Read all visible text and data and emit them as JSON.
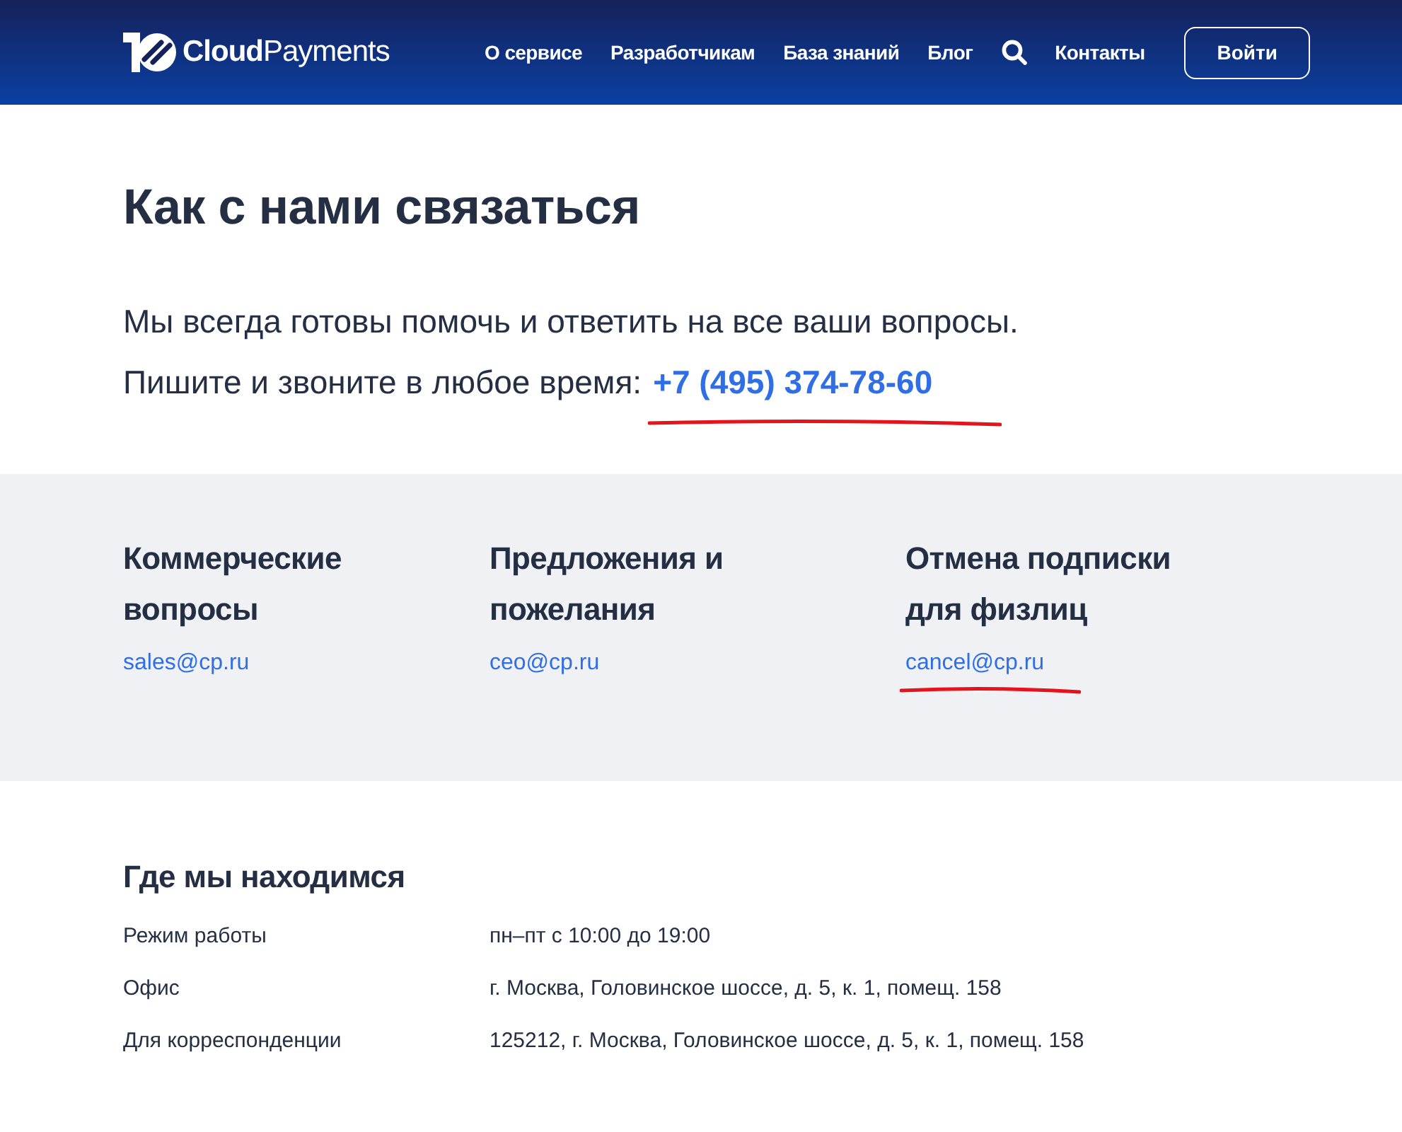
{
  "header": {
    "logo": "**Cloud**Payments",
    "nav": [
      "О сервисе",
      "Разработчикам",
      "База знаний",
      "Блог"
    ],
    "contacts_link": "Контакты",
    "login_button": "Войти"
  },
  "title": "Как с нами связаться",
  "intro": {
    "line_1": "Мы всегда готовы помочь и ответить на все ваши вопросы.",
    "line_2": "Пишите и звоните в любое время:",
    "phone": "+7 (495) 374-78-60",
    "phone_underlined": true
  },
  "contacts": [
    {
      "heading": "Коммерческие вопросы",
      "email": "sales@cp.ru",
      "underlined": false
    },
    {
      "heading": "Предложения и пожелания",
      "email": "ceo@cp.ru",
      "underlined": false
    },
    {
      "heading": "Отмена подписки для физлиц",
      "email": "cancel@cp.ru",
      "underlined": true
    }
  ],
  "location": {
    "heading": "Где мы находимся",
    "rows": [
      {
        "label": "Режим работы",
        "value": "пн–пт с 10:00 до 19:00"
      },
      {
        "label": "Офис",
        "value": "г. Москва, Головинское шоссе, д. 5, к. 1, помещ. 158"
      },
      {
        "label": "Для корреспонденции",
        "value": "125212, г. Москва, Головинское шоссе, д. 5, к. 1, помещ. 158"
      }
    ]
  }
}
